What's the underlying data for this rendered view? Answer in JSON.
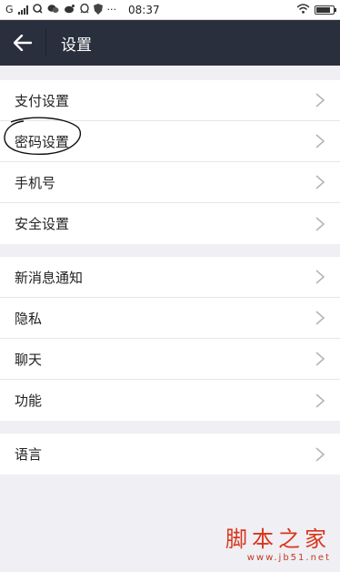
{
  "status_bar": {
    "carrier": "G",
    "time": "08:37",
    "app_icons": [
      "q-icon",
      "wechat-icon",
      "weibo-icon",
      "qq-icon",
      "shield-icon"
    ],
    "more": "···",
    "battery_level": 0.85
  },
  "header": {
    "title": "设置",
    "bg_color": "#2a2f3d"
  },
  "groups": [
    {
      "items": [
        {
          "label": "支付设置"
        },
        {
          "label": "密码设置"
        },
        {
          "label": "手机号"
        },
        {
          "label": "安全设置"
        }
      ]
    },
    {
      "items": [
        {
          "label": "新消息通知"
        },
        {
          "label": "隐私"
        },
        {
          "label": "聊天"
        },
        {
          "label": "功能"
        }
      ]
    },
    {
      "items": [
        {
          "label": "语言"
        }
      ]
    }
  ],
  "watermark": {
    "main": "脚本之家",
    "sub": "www.jb51.net",
    "color": "#d9361c"
  }
}
